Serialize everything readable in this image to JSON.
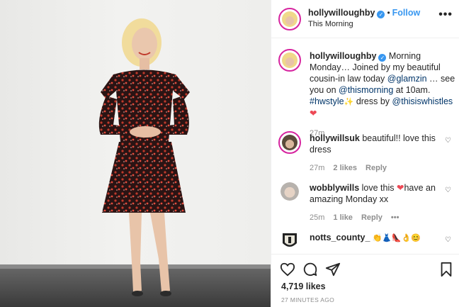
{
  "post": {
    "username": "hollywilloughby",
    "location": "This Morning",
    "follow_label": "Follow",
    "more_icon": "•••",
    "verified_icon": "✓"
  },
  "caption": {
    "username": "hollywilloughby",
    "text_a": " Morning Monday… Joined by my beautiful cousin-in law today ",
    "mention_1": "@glamzin",
    "text_b": " … see you on ",
    "mention_2": "@thismorning",
    "text_c": " at 10am. ",
    "hashtag": "#hwstyle",
    "text_d": " dress by ",
    "mention_3": "@thisiswhistles",
    "time": "27m"
  },
  "comments": [
    {
      "username": "hollywillsuk",
      "text": " beautiful!! love this dress",
      "time": "27m",
      "likes": "2 likes",
      "reply": "Reply"
    },
    {
      "username": "wobblywills",
      "text_a": " love this ",
      "text_b": "have an amazing Monday xx",
      "time": "25m",
      "likes": "1 like",
      "reply": "Reply",
      "more": "•••"
    },
    {
      "username": "notts_county_",
      "text": " 👏👗👠👌😊"
    }
  ],
  "footer": {
    "likes": "4,719 likes",
    "time": "27 MINUTES AGO"
  },
  "colors": {
    "accent": "#3897f0",
    "link": "#003569",
    "muted": "#8e8e8e",
    "heart": "#ed4956"
  }
}
